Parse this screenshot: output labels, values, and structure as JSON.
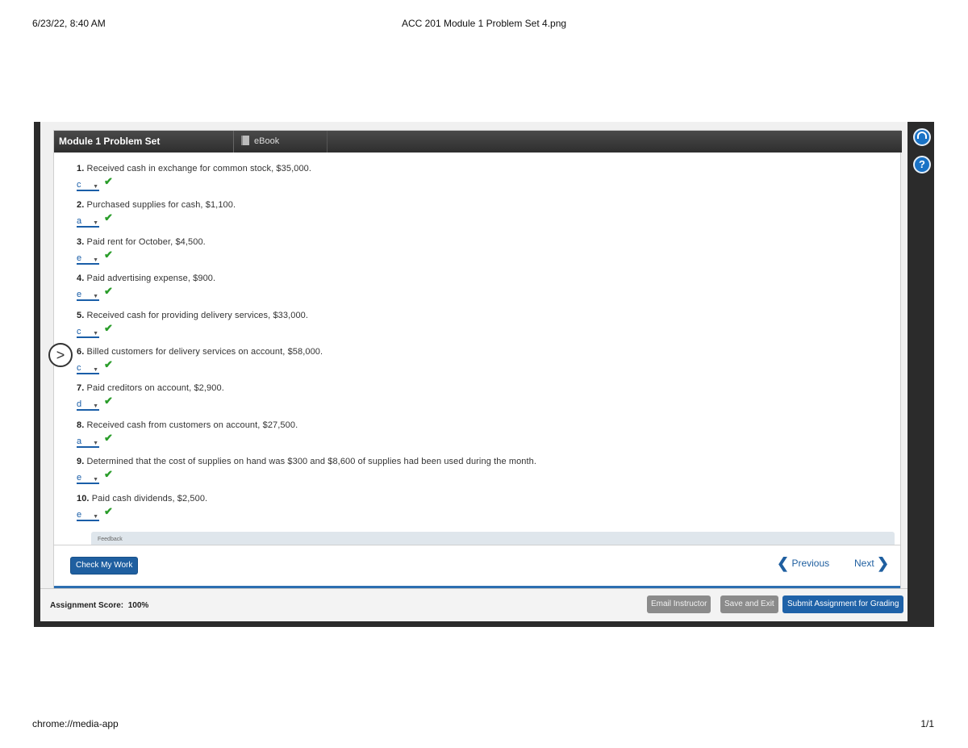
{
  "print": {
    "datetime": "6/23/22, 8:40 AM",
    "doc_title": "ACC 201 Module 1 Problem Set 4.png",
    "url": "chrome://media-app",
    "page": "1/1"
  },
  "header": {
    "title": "Module 1 Problem Set",
    "ebook_tab": "eBook"
  },
  "side_icons": {
    "support": "headset-icon",
    "help": "?"
  },
  "questions": [
    {
      "num": "1.",
      "text": "Received cash in exchange for common stock, $35,000.",
      "answer": "c"
    },
    {
      "num": "2.",
      "text": "Purchased supplies for cash, $1,100.",
      "answer": "a"
    },
    {
      "num": "3.",
      "text": "Paid rent for October, $4,500.",
      "answer": "e"
    },
    {
      "num": "4.",
      "text": "Paid advertising expense, $900.",
      "answer": "e"
    },
    {
      "num": "5.",
      "text": "Received cash for providing delivery services, $33,000.",
      "answer": "c"
    },
    {
      "num": "6.",
      "text": "Billed customers for delivery services on account, $58,000.",
      "answer": "c"
    },
    {
      "num": "7.",
      "text": "Paid creditors on account, $2,900.",
      "answer": "d"
    },
    {
      "num": "8.",
      "text": "Received cash from customers on account, $27,500.",
      "answer": "a"
    },
    {
      "num": "9.",
      "text": "Determined that the cost of supplies on hand was $300 and $8,600 of supplies had been used during the month.",
      "answer": "e"
    },
    {
      "num": "10.",
      "text": "Paid cash dividends, $2,500.",
      "answer": "e"
    }
  ],
  "feedback_label": "Feedback",
  "nav": {
    "check_work": "Check My Work",
    "previous": "Previous",
    "next": "Next",
    "expand_arrow": ">"
  },
  "score": {
    "label": "Assignment Score:",
    "value": "100%"
  },
  "actions": {
    "email": "Email Instructor",
    "save": "Save and Exit",
    "submit": "Submit Assignment for Grading"
  },
  "colors": {
    "accent": "#1f5fa0",
    "correct": "#2a9d2a",
    "titlebar": "#2e2e2e"
  }
}
